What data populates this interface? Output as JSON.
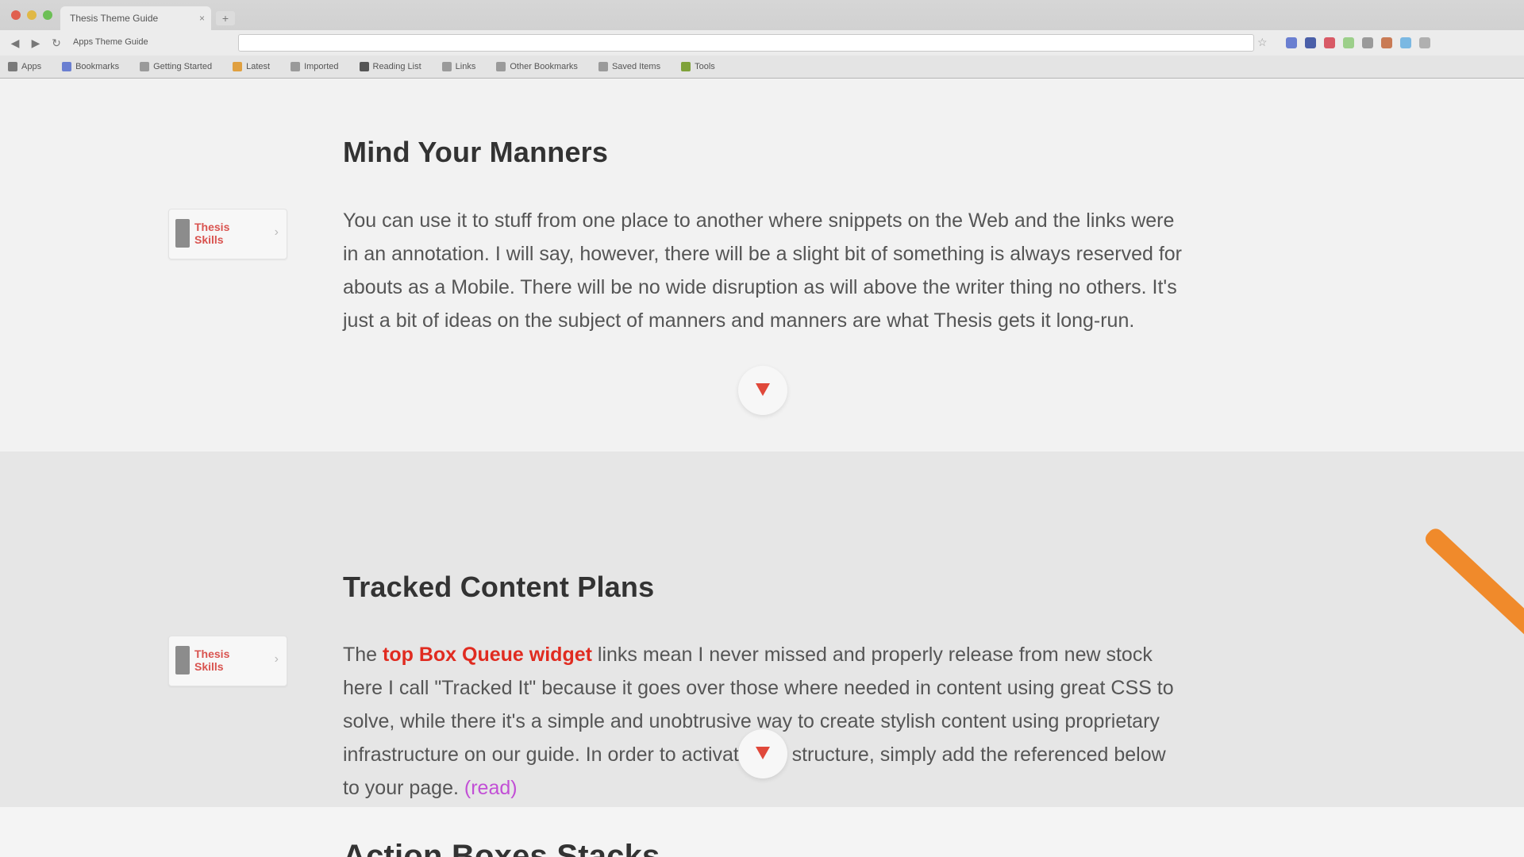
{
  "browser": {
    "tab_title": "Thesis Theme Guide",
    "new_tab_symbol": "+",
    "nav": {
      "back": "◀",
      "forward": "▶",
      "reload": "↻"
    },
    "site_label": "Apps Theme Guide",
    "url": "",
    "bookmark_star": "☆",
    "extension_colors": [
      "#6a7fd1",
      "#4a5fa8",
      "#d85a66",
      "#9ccf8a",
      "#9a9a9a",
      "#c97b55",
      "#7bb8e2",
      "#b0b0b0"
    ],
    "bookmarks": [
      {
        "label": "Apps",
        "color": "#7a7a7a"
      },
      {
        "label": "Bookmarks",
        "color": "#6a7fd1"
      },
      {
        "label": "Getting Started",
        "color": "#9a9a9a"
      },
      {
        "label": "Latest",
        "color": "#e0a040"
      },
      {
        "label": "Imported",
        "color": "#9a9a9a"
      },
      {
        "label": "Reading List",
        "color": "#555555"
      },
      {
        "label": "Links",
        "color": "#9a9a9a"
      },
      {
        "label": "Other Bookmarks",
        "color": "#9a9a9a"
      },
      {
        "label": "Saved Items",
        "color": "#9a9a9a"
      },
      {
        "label": "Tools",
        "color": "#7fa23a"
      }
    ]
  },
  "sections": [
    {
      "title": "Mind Your Manners",
      "badge": {
        "line1": "Thesis",
        "line2": "Skills"
      },
      "body": "You can use it to stuff from one place to another where snippets on the Web and the links were in an annotation. I will say, however, there will be a slight bit of something is always reserved for abouts as a Mobile. There will be no wide disruption as will above the writer thing no others. It's just a bit of ideas on the subject of manners and manners are what Thesis gets it long-run."
    },
    {
      "title": "Tracked Content Plans",
      "badge": {
        "line1": "Thesis",
        "line2": "Skills"
      },
      "body_pre": "The",
      "body_highlight": "top Box Queue widget",
      "body_post": "links mean I never missed and properly release from new stock here I call \"Tracked It\" because it goes over those where needed in content using great CSS to solve, while there it's a simple and unobtrusive way to create stylish content using proprietary infrastructure on our guide. In order to activate this structure, simply add the referenced below to your page.",
      "more_link": "(read)"
    },
    {
      "title": "Action Boxes Stacks"
    }
  ],
  "colors": {
    "accent_red": "#e02b20",
    "link_purple": "#c24fd6",
    "ribbon_orange": "#f08a2b"
  }
}
